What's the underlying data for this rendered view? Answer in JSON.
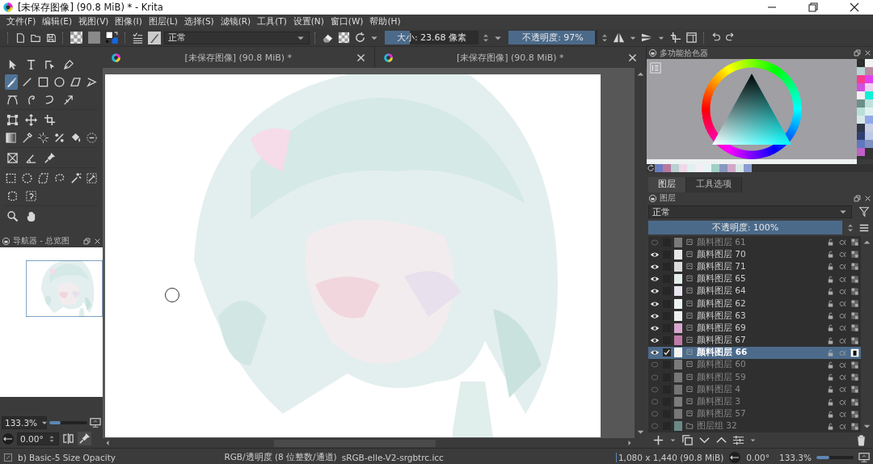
{
  "window": {
    "title": "[未保存图像]  (90.8 MiB) * - Krita"
  },
  "menu": [
    "文件(F)",
    "编辑(E)",
    "视图(V)",
    "图像(I)",
    "图层(L)",
    "选择(S)",
    "滤镜(R)",
    "工具(T)",
    "设置(N)",
    "窗口(W)",
    "帮助(H)"
  ],
  "toolbar": {
    "blend_mode": "正常",
    "size": {
      "text": "大小:  23.68 像素",
      "level": 0.27
    },
    "opacity": {
      "text": "不透明度:  97%",
      "level": 0.97
    }
  },
  "toolbox": [
    [
      {
        "kind": "pointer",
        "selected": false
      },
      {
        "kind": "text",
        "selected": false
      },
      {
        "kind": "shape-edit",
        "selected": false
      },
      {
        "kind": "pen",
        "selected": false
      }
    ],
    [
      {
        "kind": "brush",
        "selected": true
      },
      {
        "kind": "line",
        "selected": false
      },
      {
        "kind": "rectangle",
        "selected": false
      },
      {
        "kind": "ellipse",
        "selected": false
      },
      {
        "kind": "polygon",
        "selected": false
      },
      {
        "kind": "polyline",
        "selected": false
      }
    ],
    [
      {
        "kind": "curve",
        "selected": false
      },
      {
        "kind": "freehand-path",
        "selected": false
      },
      {
        "kind": "spiral",
        "selected": false
      },
      {
        "kind": "multibrush",
        "selected": false
      }
    ],
    [
      {
        "kind": "transform",
        "selected": false
      },
      {
        "kind": "move",
        "selected": false
      },
      {
        "kind": "crop",
        "selected": false
      }
    ],
    [
      {
        "kind": "gradient",
        "selected": false
      },
      {
        "kind": "eyedropper",
        "selected": false
      },
      {
        "kind": "sparkle",
        "selected": false
      },
      {
        "kind": "percent",
        "selected": false
      },
      {
        "kind": "bucket",
        "selected": false
      },
      {
        "kind": "dashed-circle",
        "selected": false
      }
    ],
    [
      {
        "kind": "cross",
        "selected": false
      },
      {
        "kind": "angle",
        "selected": false
      },
      {
        "kind": "pin",
        "selected": false
      }
    ],
    [
      {
        "kind": "dashed-rectangle",
        "selected": false
      },
      {
        "kind": "dashed-ellipse",
        "selected": false
      },
      {
        "kind": "dashed-polygon",
        "selected": false
      },
      {
        "kind": "dashed-lasso",
        "selected": false
      },
      {
        "kind": "wand",
        "selected": false
      },
      {
        "kind": "dashed-eyedropper",
        "selected": false
      }
    ],
    [
      {
        "kind": "dashed-curve",
        "selected": false
      },
      {
        "kind": "dashed-magnet",
        "selected": false
      }
    ],
    [
      {
        "kind": "magnifier",
        "selected": false
      },
      {
        "kind": "hand",
        "selected": false
      }
    ]
  ],
  "navigator": {
    "title": "导航器 - 总览图",
    "zoom": {
      "value": "133.3%",
      "level": 0.3
    },
    "rotation": "0.00°"
  },
  "documents": [
    {
      "title": "[未保存图像]  (90.8 MiB) *"
    },
    {
      "title": "[未保存图像]  (90.8 MiB) *"
    }
  ],
  "color_selector": {
    "title": "多功能拾色器",
    "palette": [
      {
        "color": "#f0f4f4"
      },
      {
        "color": "#b8d4d4"
      },
      {
        "color": "#b88ca0"
      },
      {
        "color": "#f83c8c"
      },
      {
        "color": "#e040f0"
      },
      {
        "color": "#d050e0"
      },
      {
        "color": "#f0d0f0"
      },
      {
        "color": "#f4f0f0"
      },
      {
        "color": "#10f0d8"
      },
      {
        "color": "#6a9088"
      },
      {
        "color": "#c0e0dc"
      },
      {
        "color": "#b8e0d8"
      },
      {
        "color": "#e0f0f0"
      },
      {
        "color": "#d8e8e8"
      },
      {
        "color": "#90a8e8"
      },
      {
        "color": "#303848"
      },
      {
        "color": "#c8d0e8"
      },
      {
        "color": "#304070"
      },
      {
        "color": "#c0c8e8"
      },
      {
        "color": "#6078c0"
      },
      {
        "color": "#8090c0"
      },
      {
        "color": "#c060c8"
      }
    ],
    "history": [
      {
        "color": "#6a7cc0"
      },
      {
        "color": "#b878a0"
      },
      {
        "color": "#b8d0d0"
      },
      {
        "color": "#f0d8e8"
      },
      {
        "color": "#e0f0f0"
      },
      {
        "color": "#f4eef4"
      },
      {
        "color": "#e8f4f4"
      },
      {
        "color": "#a0d0c8"
      },
      {
        "color": "#8898c0"
      },
      {
        "color": "#d0a8c8"
      },
      {
        "color": "#d8e8e8"
      },
      {
        "color": "#8c9cd0"
      }
    ]
  },
  "docker_tabs": [
    {
      "label": "图层",
      "selected": true
    },
    {
      "label": "工具选项",
      "selected": false
    }
  ],
  "layers": {
    "title": "图层",
    "blend_mode": "正常",
    "opacity": {
      "text": "不透明度:  100%",
      "level": 1
    },
    "items": [
      {
        "name": "颜料图层 61",
        "kind": "paint",
        "visible": false,
        "checked": false,
        "selected": false,
        "color": "#7a7a7a"
      },
      {
        "name": "颜料图层 70",
        "kind": "paint",
        "visible": true,
        "checked": false,
        "selected": false,
        "color": "#e8e8e8"
      },
      {
        "name": "颜料图层 71",
        "kind": "paint",
        "visible": true,
        "checked": false,
        "selected": false,
        "color": "#dcdcdc"
      },
      {
        "name": "颜料图层 65",
        "kind": "paint",
        "visible": true,
        "checked": false,
        "selected": false,
        "color": "#e4eeec"
      },
      {
        "name": "颜料图层 64",
        "kind": "paint",
        "visible": true,
        "checked": false,
        "selected": false,
        "color": "#e8e4f0"
      },
      {
        "name": "颜料图层 62",
        "kind": "paint",
        "visible": true,
        "checked": false,
        "selected": false,
        "color": "#eef4f4"
      },
      {
        "name": "颜料图层 63",
        "kind": "paint",
        "visible": true,
        "checked": false,
        "selected": false,
        "color": "#f0f0f0"
      },
      {
        "name": "颜料图层 69",
        "kind": "paint",
        "visible": true,
        "checked": false,
        "selected": false,
        "color": "#d8a8d0"
      },
      {
        "name": "颜料图层 67",
        "kind": "paint",
        "visible": true,
        "checked": false,
        "selected": false,
        "color": "#c07aa8"
      },
      {
        "name": "颜料图层 66",
        "kind": "paint",
        "visible": true,
        "checked": true,
        "selected": true,
        "color": "#f4f2f2"
      },
      {
        "name": "颜料图层 60",
        "kind": "paint",
        "visible": false,
        "checked": false,
        "selected": false,
        "color": "#7a7a7a"
      },
      {
        "name": "颜料图层 59",
        "kind": "paint",
        "visible": false,
        "checked": false,
        "selected": false,
        "color": "#777777"
      },
      {
        "name": "颜料图层 4",
        "kind": "paint",
        "visible": false,
        "checked": false,
        "selected": false,
        "color": "#747474"
      },
      {
        "name": "颜料图层 3",
        "kind": "paint",
        "visible": false,
        "checked": false,
        "selected": false,
        "color": "#7c7c7c"
      },
      {
        "name": "颜料图层 57",
        "kind": "paint",
        "visible": false,
        "checked": false,
        "selected": false,
        "color": "#787878"
      },
      {
        "name": "图层组 32",
        "kind": "group",
        "visible": false,
        "checked": false,
        "selected": false,
        "color": "#6a8a88"
      }
    ]
  },
  "status_bar": {
    "brush": "b) Basic-5 Size Opacity",
    "color_model": "RGB/透明度 (8 位整数/通道)",
    "profile": "sRGB-elle-V2-srgbtrc.icc",
    "dimensions": "1,080 x 1,440 (90.8 MiB)",
    "rotation": "0.00°",
    "zoom": {
      "value": "133.3%",
      "level": 0.35
    }
  }
}
